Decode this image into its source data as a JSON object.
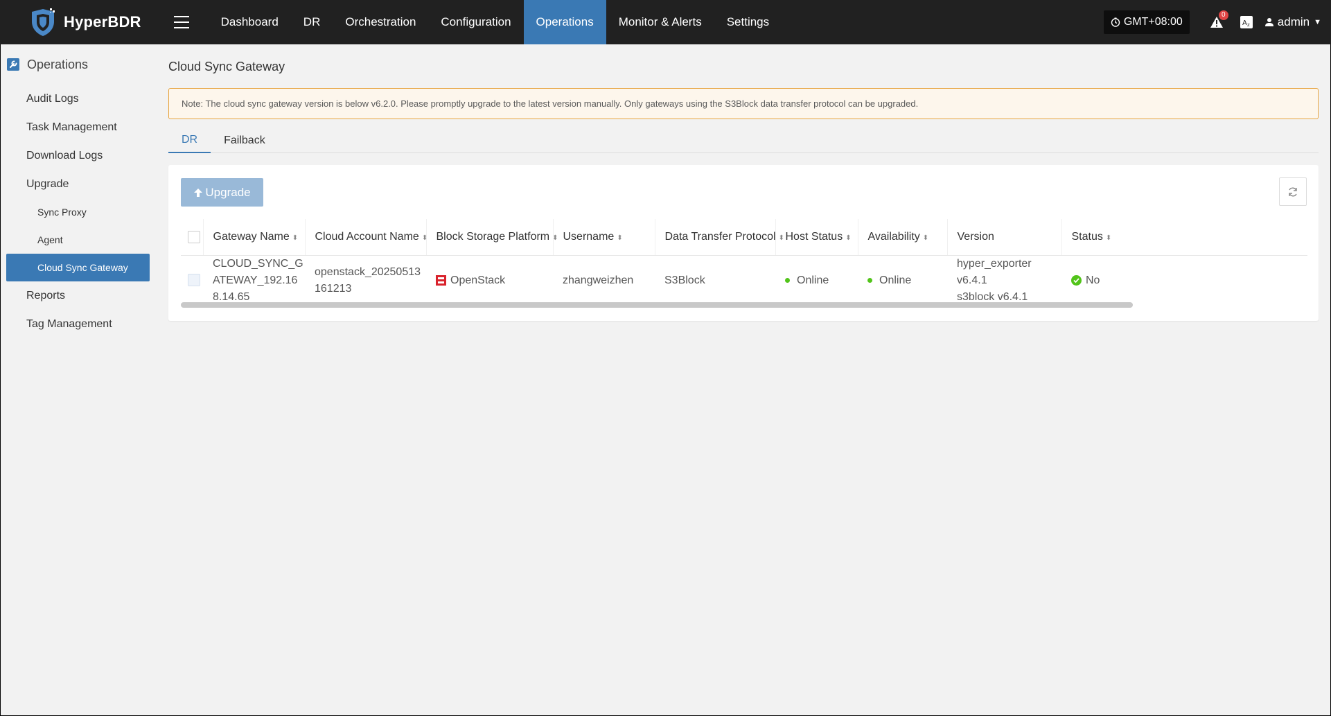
{
  "app": {
    "name": "HyperBDR"
  },
  "nav": [
    {
      "label": "Dashboard",
      "active": false
    },
    {
      "label": "DR",
      "active": false
    },
    {
      "label": "Orchestration",
      "active": false
    },
    {
      "label": "Configuration",
      "active": false
    },
    {
      "label": "Operations",
      "active": true
    },
    {
      "label": "Monitor & Alerts",
      "active": false
    },
    {
      "label": "Settings",
      "active": false
    }
  ],
  "topbar": {
    "timezone": "GMT+08:00",
    "alert_count": "0",
    "user": "admin"
  },
  "sidebar": {
    "section": "Operations",
    "items": [
      {
        "label": "Audit Logs"
      },
      {
        "label": "Task Management"
      },
      {
        "label": "Download Logs"
      },
      {
        "label": "Upgrade"
      },
      {
        "label": "Sync Proxy"
      },
      {
        "label": "Agent"
      },
      {
        "label": "Cloud Sync Gateway"
      },
      {
        "label": "Reports"
      },
      {
        "label": "Tag Management"
      }
    ]
  },
  "page": {
    "title": "Cloud Sync Gateway",
    "note": "Note: The cloud sync gateway version is below v6.2.0. Please promptly upgrade to the latest version manually. Only gateways using the S3Block data transfer protocol can be upgraded.",
    "tabs": [
      {
        "label": "DR",
        "active": true
      },
      {
        "label": "Failback",
        "active": false
      }
    ],
    "upgrade_label": "Upgrade"
  },
  "table": {
    "headers": [
      "Gateway Name",
      "Cloud Account Name",
      "Block Storage Platform",
      "Username",
      "Data Transfer Protocol",
      "Host Status",
      "Availability",
      "Version",
      "Status"
    ],
    "rows": [
      {
        "gateway_name": "CLOUD_SYNC_GATEWAY_192.168.14.65",
        "cloud_account": "openstack_20250513161213",
        "platform": "OpenStack",
        "username": "zhangweizhen",
        "protocol": "S3Block",
        "host_status": "Online",
        "availability": "Online",
        "version_1": "hyper_exporter v6.4.1",
        "version_2": "s3block v6.4.1",
        "status": "No"
      }
    ]
  },
  "colors": {
    "topbar": "#212121",
    "accent": "#3a79b4",
    "online": "#52c41a",
    "warning_border": "#e6a23c",
    "openstack": "#d9232d"
  }
}
